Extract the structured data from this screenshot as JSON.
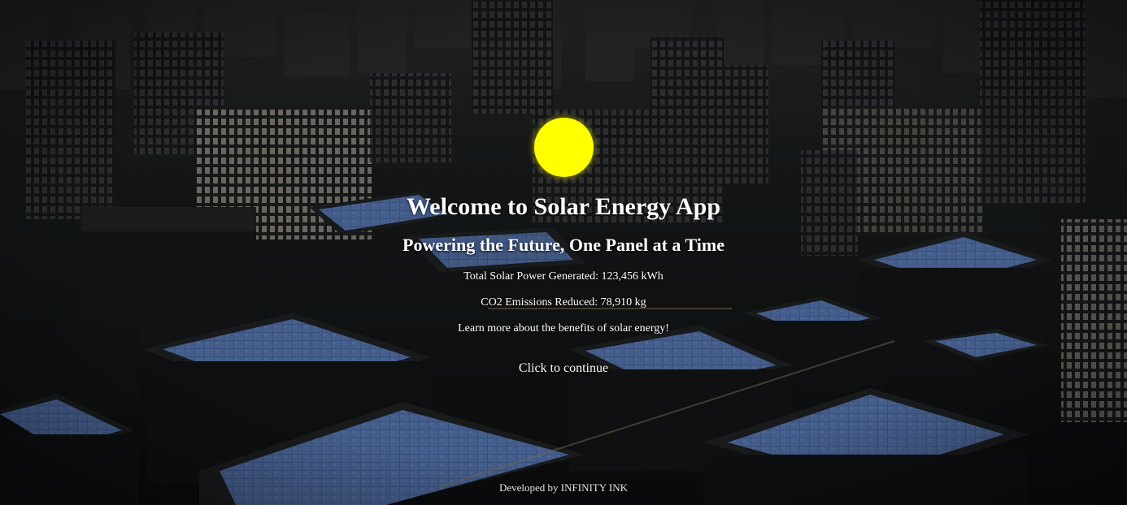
{
  "hero": {
    "title": "Welcome to Solar Energy App",
    "subtitle": "Powering the Future, One Panel at a Time",
    "sun_color": "#ffff00"
  },
  "stats": {
    "power": "Total Solar Power Generated: 123,456 kWh",
    "co2": "CO2 Emissions Reduced: 78,910 kg"
  },
  "info": {
    "learn_more": "Learn more about the benefits of solar energy!"
  },
  "actions": {
    "continue_label": "Click to continue"
  },
  "footer": {
    "credit": "Developed by INFINITY INK"
  },
  "colors": {
    "text": "#ffffff",
    "panel_blue": "#4a6aa8",
    "building_dark": "#17191b",
    "window_light": "#c9c2a6"
  }
}
